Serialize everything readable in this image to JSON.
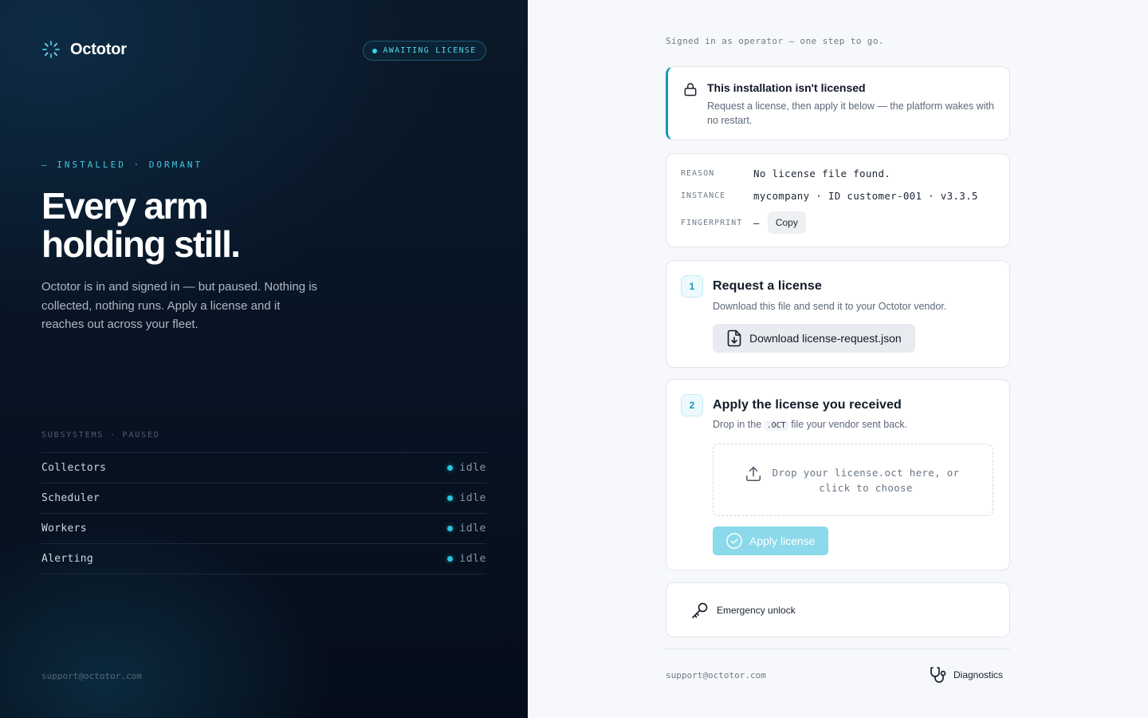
{
  "brand": {
    "name": "Octotor"
  },
  "status_pill": {
    "label": "AWAITING LICENSE"
  },
  "hero": {
    "eyebrow": "— INSTALLED · DORMANT",
    "title_line1": "Every arm",
    "title_line2": "holding still.",
    "lead": "Octotor is in and signed in — but paused. Nothing is collected, nothing runs. Apply a license and it reaches out across your fleet."
  },
  "subsystems": {
    "heading": "SUBSYSTEMS · PAUSED",
    "items": [
      {
        "name": "Collectors",
        "status": "idle"
      },
      {
        "name": "Scheduler",
        "status": "idle"
      },
      {
        "name": "Workers",
        "status": "idle"
      },
      {
        "name": "Alerting",
        "status": "idle"
      }
    ]
  },
  "left_footer": {
    "support_email": "support@octotor.com"
  },
  "signed_in_note": "Signed in as operator — one step to go.",
  "alert": {
    "title": "This installation isn't licensed",
    "subtitle": "Request a license, then apply it below — the platform wakes with no restart."
  },
  "meta": {
    "reason_label": "REASON",
    "reason_value": "No license file found.",
    "instance_label": "INSTANCE",
    "instance_value": "mycompany · ID customer-001 · v3.3.5",
    "fingerprint_label": "FINGERPRINT",
    "fingerprint_value": "—",
    "copy_label": "Copy"
  },
  "step1": {
    "number": "1",
    "title": "Request a license",
    "subtitle": "Download this file and send it to your Octotor vendor.",
    "button_label": "Download license-request.json"
  },
  "step2": {
    "number": "2",
    "title": "Apply the license you received",
    "subtitle_pre": "Drop in the ",
    "subtitle_code": ".OCT",
    "subtitle_post": " file your vendor sent back.",
    "dropzone_text": "Drop your license.oct here, or click to choose",
    "apply_label": "Apply license"
  },
  "emergency": {
    "label": "Emergency unlock"
  },
  "right_footer": {
    "support_email": "support@octotor.com",
    "diagnostics_label": "Diagnostics"
  },
  "colors": {
    "accent": "#2bc4de",
    "dark_bg": "#081424",
    "apply_disabled": "#8bd9ea",
    "alert_border": "#1496b8"
  },
  "icons": {
    "brand": "sparkle-spinner-icon",
    "alert": "lock-icon",
    "download": "file-download-icon",
    "dropzone": "upload-icon",
    "apply": "check-circle-icon",
    "emergency": "key-icon",
    "diagnostics": "stethoscope-icon"
  }
}
